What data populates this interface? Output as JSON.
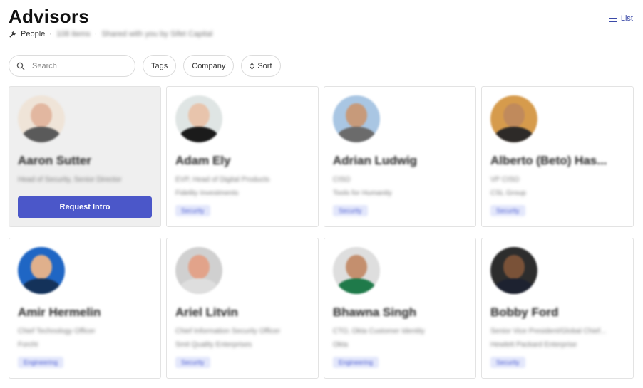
{
  "header": {
    "title": "Advisors",
    "category": "People",
    "count_text": "108 items",
    "shared_text": "Shared with you by Sifet Capital"
  },
  "view_toggle": {
    "label": "List"
  },
  "filters": {
    "search_placeholder": "Search",
    "tags_label": "Tags",
    "company_label": "Company",
    "sort_label": "Sort"
  },
  "cards": [
    {
      "name": "Aaron Sutter",
      "role": "Head of Security, Senior Director",
      "company": "",
      "tag": "",
      "button": "Request Intro",
      "skin": "#e2b7a0",
      "shirt": "#5a5a5a",
      "bg": "#efe4d8"
    },
    {
      "name": "Adam Ely",
      "role": "EVP, Head of Digital Products",
      "company": "Fidelity Investments",
      "tag": "Security",
      "skin": "#e8c4ac",
      "shirt": "#1b1b1b",
      "bg": "#dfe5e4"
    },
    {
      "name": "Adrian Ludwig",
      "role": "CISO",
      "company": "Tools for Humanity",
      "tag": "Security",
      "skin": "#c79a7a",
      "shirt": "#6b6b6b",
      "bg": "#a9c6e3"
    },
    {
      "name": "Alberto (Beto) Has...",
      "role": "VP CISO",
      "company": "CSL Group",
      "tag": "Security",
      "skin": "#c08a5c",
      "shirt": "#2d2a28",
      "bg": "#d69b4c"
    },
    {
      "name": "Amir Hermelin",
      "role": "Chief Technology Officer",
      "company": "Forcht",
      "tag": "Engineering",
      "skin": "#e0b08c",
      "shirt": "#14325a",
      "bg": "#1f66c4"
    },
    {
      "name": "Ariel Litvin",
      "role": "Chief Information Security Officer",
      "company": "Smit Quality Enterprises",
      "tag": "Security",
      "skin": "#e2a38a",
      "shirt": "#dedede",
      "bg": "#d0d0d0"
    },
    {
      "name": "Bhawna Singh",
      "role": "CTO, Okta Customer Identity",
      "company": "Okta",
      "tag": "Engineering",
      "skin": "#c48f6e",
      "shirt": "#1f7a4a",
      "bg": "#dedede"
    },
    {
      "name": "Bobby Ford",
      "role": "Senior Vice President/Global Chief...",
      "company": "Hewlett Packard Enterprise",
      "tag": "Security",
      "skin": "#7a5238",
      "shirt": "#1d2230",
      "bg": "#2d2d2d"
    }
  ]
}
